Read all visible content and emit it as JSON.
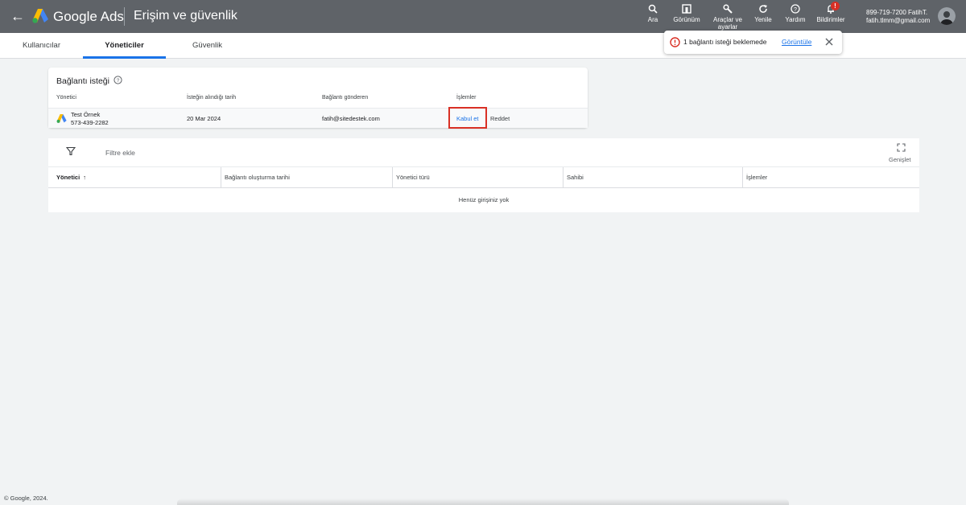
{
  "header": {
    "back_icon": "arrow-back-icon",
    "brand": "Google Ads",
    "page_title": "Erişim ve güvenlik",
    "tools": [
      {
        "label": "Ara",
        "icon": "search-icon"
      },
      {
        "label": "Görünüm",
        "icon": "view-icon"
      },
      {
        "label": "Araçlar ve ayarlar",
        "icon": "wrench-icon"
      },
      {
        "label": "Yenile",
        "icon": "refresh-icon"
      },
      {
        "label": "Yardım",
        "icon": "help-icon"
      },
      {
        "label": "Bildirimler",
        "icon": "bell-icon",
        "badge": "!"
      }
    ],
    "account": {
      "name": "899-719-7200 FatihT.",
      "email": "fatih.tlmm@gmail.com"
    }
  },
  "tabs": [
    {
      "label": "Kullanıcılar"
    },
    {
      "label": "Yöneticiler",
      "active": true
    },
    {
      "label": "Güvenlik"
    }
  ],
  "toast": {
    "message": "1 bağlantı isteği beklemede",
    "link": "Görüntüle"
  },
  "request_card": {
    "title": "Bağlantı isteği",
    "headers": [
      "Yönetici",
      "İsteğin alındığı tarih",
      "Bağlantı gönderen",
      "İşlemler"
    ],
    "row": {
      "name": "Test Örnek",
      "id": "573-439-2282",
      "date": "20 Mar 2024",
      "sender": "fatih@sitedestek.com",
      "accept": "Kabul et",
      "reject": "Reddet"
    }
  },
  "managers_table": {
    "filter_label": "Filtre ekle",
    "expand_label": "Genişlet",
    "columns": [
      "Yönetici",
      "Bağlantı oluşturma tarihi",
      "Yönetici türü",
      "Sahibi",
      "İşlemler"
    ],
    "empty_text": "Henüz girişiniz yok"
  },
  "footer": "© Google, 2024.",
  "colors": {
    "topbar": "#5f6368",
    "accent": "#1a73e8",
    "alert": "#d93025"
  }
}
